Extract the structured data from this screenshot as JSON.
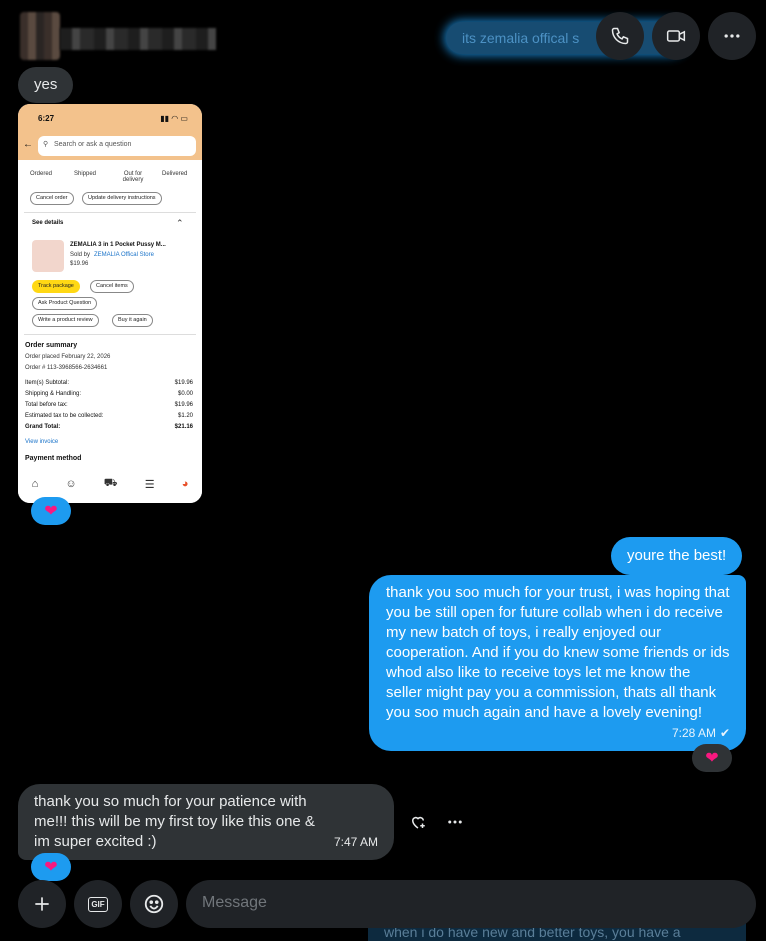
{
  "header": {
    "preview_text": "its zemalia offical s",
    "phone_icon": "phone-icon",
    "video_icon": "video-icon",
    "more_icon": "more-icon"
  },
  "messages": [
    {
      "text": "yes"
    },
    {
      "text": "youre the best!"
    },
    {
      "text": "thank you soo much for your trust, i was hoping that you be still open for future collab when i do receive my new batch of toys, i really enjoyed our cooperation. And if you do knew some friends or ids whod also like to receive toys let me know the seller might pay you a commission, thats all thank you soo much again and have a lovely evening!",
      "time": "7:28 AM"
    },
    {
      "text": "thank you so much for your patience with me!!! this will be my first toy like this one & im super excited :)",
      "time": "7:47 AM"
    }
  ],
  "reaction": "heart",
  "screenshot": {
    "status_time": "6:27",
    "search_placeholder": "Search or ask a question",
    "steps": [
      "Ordered",
      "Shipped",
      "Out for delivery",
      "Delivered"
    ],
    "btn_cancel_order": "Cancel order",
    "btn_update": "Update delivery instructions",
    "see_details": "See details",
    "product_title": "ZEMALIA 3 in 1 Pocket Pussy M...",
    "sold_by_prefix": "Sold by",
    "sold_by": "ZEMALIA Offical Store",
    "price": "$19.96",
    "btn_track": "Track package",
    "btn_cancel_items": "Cancel items",
    "btn_ask": "Ask Product Question",
    "btn_review": "Write a product review",
    "btn_buy_again": "Buy it again",
    "summary_title": "Order summary",
    "order_placed": "Order placed February 22, 2026",
    "order_number": "Order # 113-3968566-2634661",
    "rows": [
      {
        "label": "Item(s) Subtotal:",
        "value": "$19.96"
      },
      {
        "label": "Shipping & Handling:",
        "value": "$0.00"
      },
      {
        "label": "Total before tax:",
        "value": "$19.96"
      },
      {
        "label": "Estimated tax to be collected:",
        "value": "$1.20"
      },
      {
        "label": "Grand Total:",
        "value": "$21.16"
      }
    ],
    "view_invoice": "View invoice",
    "payment_method": "Payment method"
  },
  "composer": {
    "placeholder": "Message",
    "gif_label": "GIF",
    "underlay_text": "when i do have new and better toys, you have a"
  }
}
